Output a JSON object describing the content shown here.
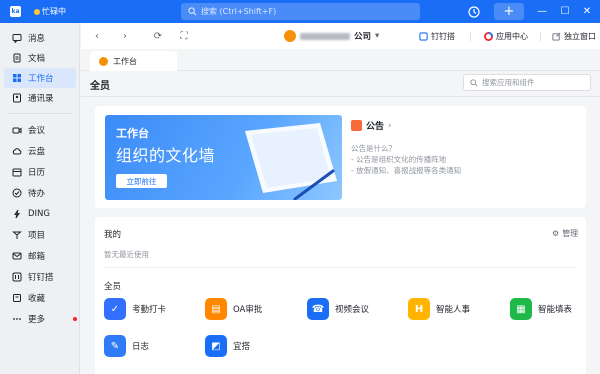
{
  "topbar": {
    "logo_text": "ka",
    "status_label": "忙碌中",
    "search_placeholder": "搜索 (Ctrl+Shift+F)",
    "plus_label": "+"
  },
  "sidebar": {
    "items": [
      {
        "label": "消息",
        "icon": "message-icon"
      },
      {
        "label": "文档",
        "icon": "document-icon"
      },
      {
        "label": "工作台",
        "icon": "workbench-icon"
      },
      {
        "label": "通讯录",
        "icon": "contacts-icon"
      },
      {
        "label": "会议",
        "icon": "meeting-icon"
      },
      {
        "label": "云盘",
        "icon": "cloud-icon"
      },
      {
        "label": "日历",
        "icon": "calendar-icon"
      },
      {
        "label": "待办",
        "icon": "todo-icon"
      },
      {
        "label": "DING",
        "icon": "ding-icon"
      },
      {
        "label": "项目",
        "icon": "project-icon"
      },
      {
        "label": "邮箱",
        "icon": "mail-icon"
      },
      {
        "label": "钉钉搭",
        "icon": "builder-icon"
      },
      {
        "label": "收藏",
        "icon": "favorite-icon"
      },
      {
        "label": "更多",
        "icon": "more-icon"
      }
    ],
    "active_index": 2
  },
  "toolbar": {
    "org_name_suffix": "公司",
    "dingtalk_btn": "钉钉搭",
    "app_center_btn": "应用中心",
    "window_btn": "独立窗口"
  },
  "tab": {
    "label": "工作台"
  },
  "panel": {
    "title": "全员",
    "search_placeholder": "搜索应用和组件"
  },
  "banner": {
    "line1": "工作台",
    "line2": "组织的文化墙",
    "button": "立即前往"
  },
  "notice": {
    "title": "公告",
    "lines": [
      "公告是什么？",
      "- 公告是组织文化的传播阵地",
      "- 放假通知、喜报战报等各类通知"
    ]
  },
  "mine": {
    "title": "我的",
    "manage": "管理",
    "empty": "暂无最近使用"
  },
  "all": {
    "title": "全员",
    "apps": [
      {
        "label": "考勤打卡",
        "color": "#3370ff",
        "glyph": "✓"
      },
      {
        "label": "OA审批",
        "color": "#ff8800",
        "glyph": "▤"
      },
      {
        "label": "视频会议",
        "color": "#1a6ef5",
        "glyph": "☎"
      },
      {
        "label": "智能人事",
        "color": "#ffb400",
        "glyph": "H"
      },
      {
        "label": "智能填表",
        "color": "#1fb94a",
        "glyph": "▦"
      },
      {
        "label": "日志",
        "color": "#2f7bf5",
        "glyph": "✎"
      },
      {
        "label": "宜搭",
        "color": "#1a6ef5",
        "glyph": "◩"
      }
    ]
  },
  "colors": {
    "brand": "#1a6ef5",
    "active_bg": "#d9e6fc"
  }
}
